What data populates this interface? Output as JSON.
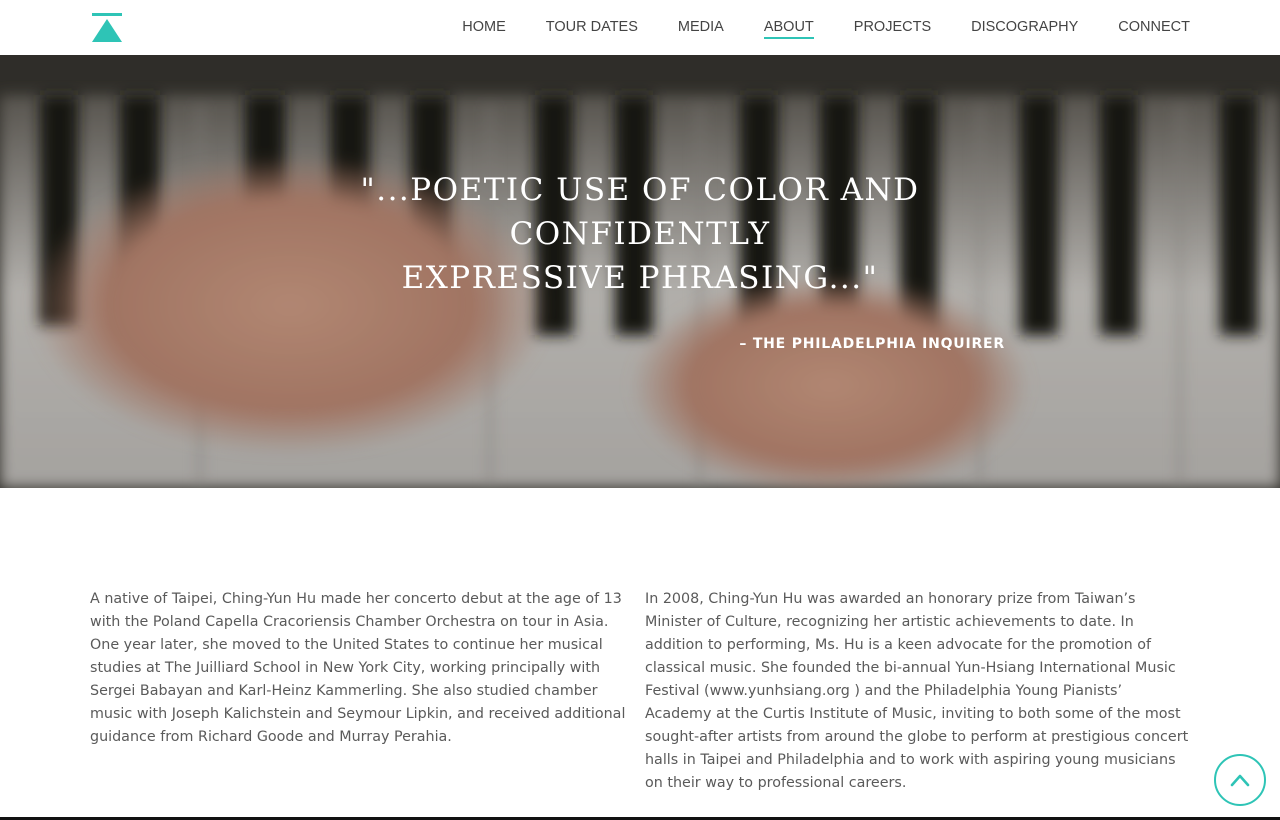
{
  "brand": {
    "logo_icon": "triangle-logo-icon",
    "accent": "#2ec4b6"
  },
  "nav": {
    "items": [
      {
        "label": "HOME",
        "active": false
      },
      {
        "label": "TOUR DATES",
        "active": false
      },
      {
        "label": "MEDIA",
        "active": false
      },
      {
        "label": "ABOUT",
        "active": true
      },
      {
        "label": "PROJECTS",
        "active": false
      },
      {
        "label": "DISCOGRAPHY",
        "active": false
      },
      {
        "label": "CONNECT",
        "active": false
      }
    ]
  },
  "hero": {
    "quote_line1": "\"...poetic use of color and confidently",
    "quote_line2": "expressive phrasing...\"",
    "attribution": "– The Philadelphia Inquirer"
  },
  "about": {
    "left_paragraph": "A native of Taipei, Ching-Yun Hu made her concerto debut at the age of 13 with the Poland Capella Cracoriensis Chamber Orchestra on tour in Asia. One year later, she moved to the United States to continue her musical studies at The Juilliard School in New York City, working principally with Sergei Babayan and Karl-Heinz Kammerling. She also studied chamber music with Joseph Kalichstein and Seymour Lipkin, and received additional guidance from Richard Goode and Murray Perahia.",
    "right_paragraph": "In 2008, Ching-Yun Hu was awarded an honorary prize from Taiwan’s Minister of Culture, recognizing her artistic achievements to date. In addition to performing, Ms. Hu is a keen advocate for the promotion of classical music. She founded the bi-annual Yun-Hsiang International Music Festival (www.yunhsiang.org ) and the Philadelphia Young Pianists’ Academy at the Curtis Institute of Music, inviting to both some of the most sought-after artists from around the globe to perform at prestigious concert halls in Taipei and Philadelphia and to work with aspiring young musicians on their way to professional careers."
  },
  "scroll_top": {
    "icon": "chevron-up-icon"
  }
}
